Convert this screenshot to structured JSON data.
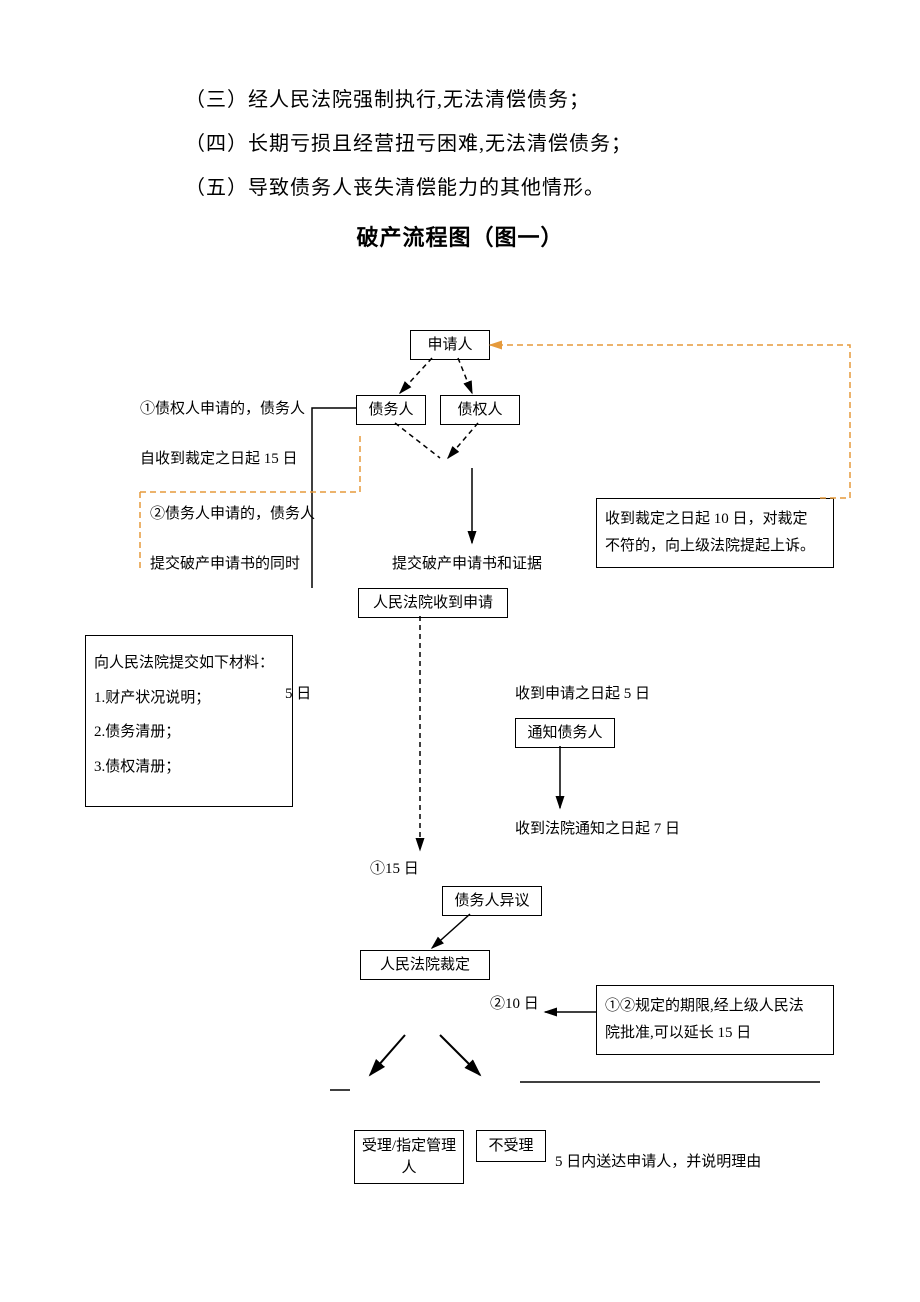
{
  "intro": {
    "line3": "（三）经人民法院强制执行,无法清偿债务；",
    "line4": "（四）长期亏损且经营扭亏困难,无法清偿债务；",
    "line5": "（五）导致债务人丧失清偿能力的其他情形。"
  },
  "title": "破产流程图（图一）",
  "boxes": {
    "applicant": "申请人",
    "debtor": "债务人",
    "creditor": "债权人",
    "court_receive": "人民法院收到申请",
    "notify_debtor": "通知债务人",
    "debtor_objection": "债务人异议",
    "court_ruling": "人民法院裁定",
    "accept": "受理/指定管理人",
    "reject": "不受理"
  },
  "labels": {
    "note1_l1": "①债权人申请的，债务人",
    "note1_l2": "自收到裁定之日起 15 日",
    "note2_l1": "②债务人申请的，债务人",
    "note2_l2": "提交破产申请书的同时",
    "materials_title": "向人民法院提交如下材料：",
    "materials_1": "1.财产状况说明；",
    "materials_2": "2.债务清册；",
    "materials_3": "3.债权清册；",
    "five_days": "5 日",
    "submit_app": "提交破产申请书和证据",
    "appeal_l1": "收到裁定之日起 10 日，对裁定",
    "appeal_l2": "不符的，向上级法院提起上诉。",
    "five_days_from": "收到申请之日起 5 日",
    "seven_days_from": "收到法院通知之日起 7 日",
    "fifteen_days": "①15 日",
    "ten_days": "②10 日",
    "extend_l1": "①②规定的期限,经上级人民法",
    "extend_l2": "院批准,可以延长 15 日",
    "five_days_deliver": "5 日内送达申请人，并说明理由"
  }
}
